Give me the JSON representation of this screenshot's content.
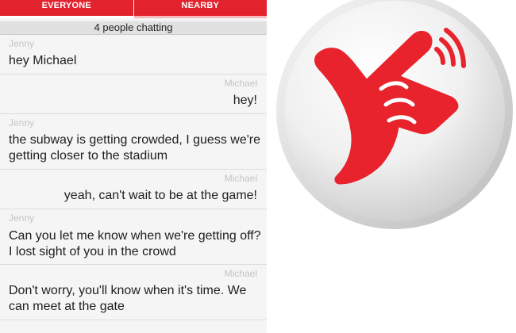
{
  "tabs": [
    {
      "label": "EVERYONE",
      "selected": true
    },
    {
      "label": "NEARBY",
      "selected": false
    }
  ],
  "status_text": "4 people chatting",
  "messages": [
    {
      "author": "Jenny",
      "text": "hey Michael",
      "side": "left"
    },
    {
      "author": "Michael",
      "text": "hey!",
      "side": "right"
    },
    {
      "author": "Jenny",
      "text": "the subway is getting crowded, I guess we're getting closer to the stadium",
      "side": "left"
    },
    {
      "author": "Michael",
      "text": "yeah, can't wait to be at the game!",
      "side": "right"
    },
    {
      "author": "Jenny",
      "text": "Can you let me know when we're getting off? I lost sight of you in the crowd",
      "side": "left"
    },
    {
      "author": "Michael",
      "text": "Don't worry, you'll know when it's time. We can meet at the gate",
      "side": "right"
    }
  ],
  "logo": {
    "icon": "shaka-hand-signal-icon"
  },
  "colors": {
    "accent": "#e2232e",
    "background": "#f5f5f5",
    "author": "#c4c4c4"
  }
}
